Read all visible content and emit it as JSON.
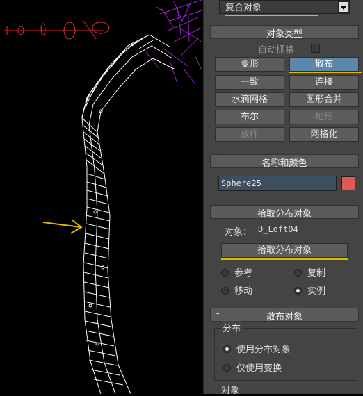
{
  "top_dropdown": {
    "value": "复合对象"
  },
  "object_type": {
    "title": "对象类型",
    "autogrid_label": "自动栅格",
    "buttons": [
      {
        "label": "变形",
        "state": "normal"
      },
      {
        "label": "散布",
        "state": "active"
      },
      {
        "label": "一致",
        "state": "normal"
      },
      {
        "label": "连接",
        "state": "normal"
      },
      {
        "label": "水滴网格",
        "state": "normal"
      },
      {
        "label": "图形合并",
        "state": "normal"
      },
      {
        "label": "布尔",
        "state": "normal"
      },
      {
        "label": "地形",
        "state": "disabled"
      },
      {
        "label": "放样",
        "state": "disabled"
      },
      {
        "label": "网格化",
        "state": "normal"
      }
    ]
  },
  "name_color": {
    "title": "名称和颜色",
    "name_value": "Sphere25",
    "color": "#e05a55"
  },
  "pick_distribution": {
    "title": "拾取分布对象",
    "object_label": "对象：",
    "object_value": "D_Loft04",
    "pick_button": "拾取分布对象",
    "options": [
      {
        "label": "参考",
        "selected": false
      },
      {
        "label": "复制",
        "selected": false
      },
      {
        "label": "移动",
        "selected": false
      },
      {
        "label": "实例",
        "selected": true
      }
    ]
  },
  "scatter_objects": {
    "title": "散布对象",
    "distribution_group": "分布",
    "use_distribution": "使用分布对象",
    "transforms_only": "仅使用变换",
    "objects_label": "对象"
  },
  "colors": {
    "panel_bg": "#444444",
    "active_blue": "#5b87ad",
    "accent_yellow": "#e0b800",
    "wire": "#ffffff",
    "scatter_purple": "#9a1fd0"
  }
}
